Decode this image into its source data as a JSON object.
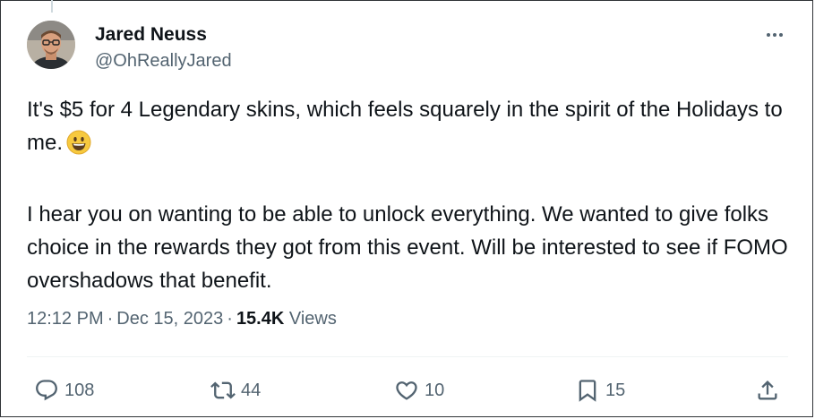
{
  "tweet": {
    "author_name": "Jared Neuss",
    "handle": "@OhReallyJared",
    "paragraph_1": "It's $5 for 4 Legendary skins, which feels squarely in the spirit of the Holidays to me.",
    "paragraph_1_emoji": "😃",
    "paragraph_2": "I hear you on wanting to be able to unlock everything. We wanted to give folks choice in the rewards they got from this event. Will be interested to see if FOMO overshadows that benefit.",
    "time": "12:12 PM",
    "date": "Dec 15, 2023",
    "separator": "·",
    "views_count": "15.4K",
    "views_label": "Views"
  },
  "actions": {
    "replies": "108",
    "reposts": "44",
    "likes": "10",
    "bookmarks": "15"
  },
  "icons": {
    "more": "more-dots-icon",
    "reply": "reply-icon",
    "repost": "repost-icon",
    "like": "heart-icon",
    "bookmark": "bookmark-icon",
    "share": "share-icon"
  },
  "colors": {
    "text": "#0f1419",
    "secondary": "#536471",
    "divider": "#eff3f4"
  }
}
